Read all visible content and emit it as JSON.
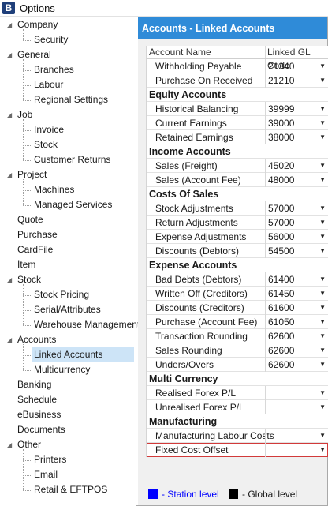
{
  "window": {
    "title": "Options"
  },
  "tree": [
    {
      "label": "Company",
      "level": 0,
      "expanded": true
    },
    {
      "label": "Security",
      "level": 1
    },
    {
      "label": "General",
      "level": 0,
      "expanded": true
    },
    {
      "label": "Branches",
      "level": 1
    },
    {
      "label": "Labour",
      "level": 1
    },
    {
      "label": "Regional Settings",
      "level": 1
    },
    {
      "label": "Job",
      "level": 0,
      "expanded": true
    },
    {
      "label": "Invoice",
      "level": 1
    },
    {
      "label": "Stock",
      "level": 1
    },
    {
      "label": "Customer Returns",
      "level": 1
    },
    {
      "label": "Project",
      "level": 0,
      "expanded": true
    },
    {
      "label": "Machines",
      "level": 1
    },
    {
      "label": "Managed Services",
      "level": 1
    },
    {
      "label": "Quote",
      "level": 0
    },
    {
      "label": "Purchase",
      "level": 0
    },
    {
      "label": "CardFile",
      "level": 0
    },
    {
      "label": "Item",
      "level": 0
    },
    {
      "label": "Stock",
      "level": 0,
      "expanded": true
    },
    {
      "label": "Stock Pricing",
      "level": 1
    },
    {
      "label": "Serial/Attributes",
      "level": 1
    },
    {
      "label": "Warehouse Management",
      "level": 1
    },
    {
      "label": "Accounts",
      "level": 0,
      "expanded": true
    },
    {
      "label": "Linked Accounts",
      "level": 1,
      "selected": true
    },
    {
      "label": "Multicurrency",
      "level": 1
    },
    {
      "label": "Banking",
      "level": 0
    },
    {
      "label": "Schedule",
      "level": 0
    },
    {
      "label": "eBusiness",
      "level": 0
    },
    {
      "label": "Documents",
      "level": 0
    },
    {
      "label": "Other",
      "level": 0,
      "expanded": true
    },
    {
      "label": "Printers",
      "level": 1
    },
    {
      "label": "Email",
      "level": 1
    },
    {
      "label": "Retail & EFTPOS",
      "level": 1
    }
  ],
  "panel": {
    "header": "Accounts - Linked Accounts",
    "columns": {
      "name": "Account Name",
      "code": "Linked GL Code"
    },
    "rows": [
      {
        "type": "item",
        "name": "Withholding Payable",
        "code": "21340"
      },
      {
        "type": "item",
        "name": "Purchase On Received",
        "code": "21210"
      },
      {
        "type": "group",
        "name": "Equity Accounts"
      },
      {
        "type": "item",
        "name": "Historical Balancing",
        "code": "39999"
      },
      {
        "type": "item",
        "name": "Current Earnings",
        "code": "39000"
      },
      {
        "type": "item",
        "name": "Retained Earnings",
        "code": "38000"
      },
      {
        "type": "group",
        "name": "Income Accounts"
      },
      {
        "type": "item",
        "name": "Sales (Freight)",
        "code": "45020"
      },
      {
        "type": "item",
        "name": "Sales (Account Fee)",
        "code": "48000"
      },
      {
        "type": "group",
        "name": "Costs Of Sales"
      },
      {
        "type": "item",
        "name": "Stock Adjustments",
        "code": "57000"
      },
      {
        "type": "item",
        "name": "Return Adjustments",
        "code": "57000"
      },
      {
        "type": "item",
        "name": "Expense Adjustments",
        "code": "56000"
      },
      {
        "type": "item",
        "name": "Discounts (Debtors)",
        "code": "54500"
      },
      {
        "type": "group",
        "name": "Expense Accounts"
      },
      {
        "type": "item",
        "name": "Bad Debts (Debtors)",
        "code": "61400"
      },
      {
        "type": "item",
        "name": "Written Off (Creditors)",
        "code": "61450"
      },
      {
        "type": "item",
        "name": "Discounts (Creditors)",
        "code": "61600"
      },
      {
        "type": "item",
        "name": "Purchase (Account Fee)",
        "code": "61050"
      },
      {
        "type": "item",
        "name": "Transaction Rounding",
        "code": "62600"
      },
      {
        "type": "item",
        "name": "Sales Rounding",
        "code": "62600"
      },
      {
        "type": "item",
        "name": "Unders/Overs",
        "code": "62600"
      },
      {
        "type": "group",
        "name": "Multi Currency"
      },
      {
        "type": "item",
        "name": "Realised Forex P/L",
        "code": ""
      },
      {
        "type": "item",
        "name": "Unrealised Forex P/L",
        "code": ""
      },
      {
        "type": "group",
        "name": "Manufacturing"
      },
      {
        "type": "item",
        "name": "Manufacturing Labour Costs",
        "code": ""
      },
      {
        "type": "item",
        "name": "Fixed Cost Offset",
        "code": "",
        "focused": true
      }
    ]
  },
  "legend": {
    "station": {
      "label": "- Station level",
      "color": "#0000ff"
    },
    "global": {
      "label": "- Global level",
      "color": "#000000"
    }
  },
  "colors": {
    "header": "#2f8bd8",
    "selection": "#cde4f7",
    "focus": "#d23a3a"
  },
  "icons": {
    "app": "app-logo-icon",
    "expand": "expand-triangle-icon",
    "dropdown": "dropdown-arrow-icon"
  }
}
